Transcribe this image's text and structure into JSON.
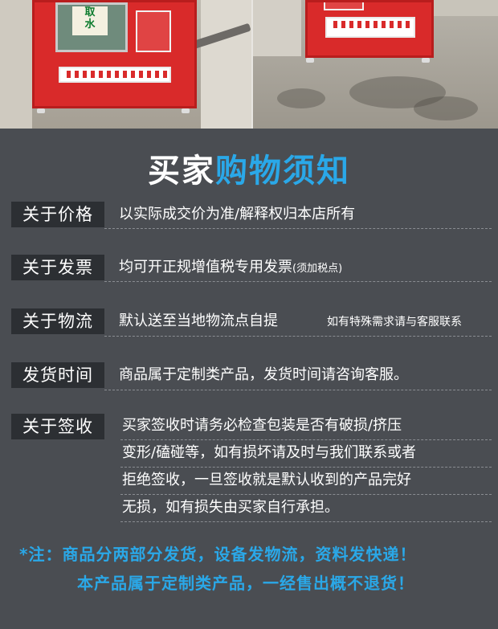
{
  "photo": {
    "sign_line1": "取",
    "sign_line2": "水"
  },
  "headline": {
    "part1": "买家",
    "part2": "购物须知"
  },
  "rows": [
    {
      "label": "关于价格",
      "text": "以实际成交价为准/解释权归本店所有",
      "note": ""
    },
    {
      "label": "关于发票",
      "text": "均可开正规增值税专用发票",
      "note": "(须加税点)"
    },
    {
      "label": "关于物流",
      "text": "默认送至当地物流点自提",
      "note": "如有特殊需求请与客服联系"
    },
    {
      "label": "发货时间",
      "text": "商品属于定制类产品，发货时间请咨询客服。",
      "note": ""
    }
  ],
  "sign_row": {
    "label": "关于签收",
    "lines": [
      "买家签收时请务必检查包装是否有破损/挤压",
      "变形/磕碰等，如有损坏请及时与我们联系或者",
      "拒绝签收，一旦签收就是默认收到的产品完好",
      "无损，如有损失由买家自行承担。"
    ]
  },
  "notes": {
    "line1": "*注：商品分两部分发货，设备发物流，资料发快递！",
    "line2": "本产品属于定制类产品，一经售出概不退货！"
  },
  "colors": {
    "background": "#4a4d52",
    "accent_blue": "#2aa8e8",
    "label_bg": "#2c2f33",
    "cabinet_red": "#d92a2a"
  }
}
